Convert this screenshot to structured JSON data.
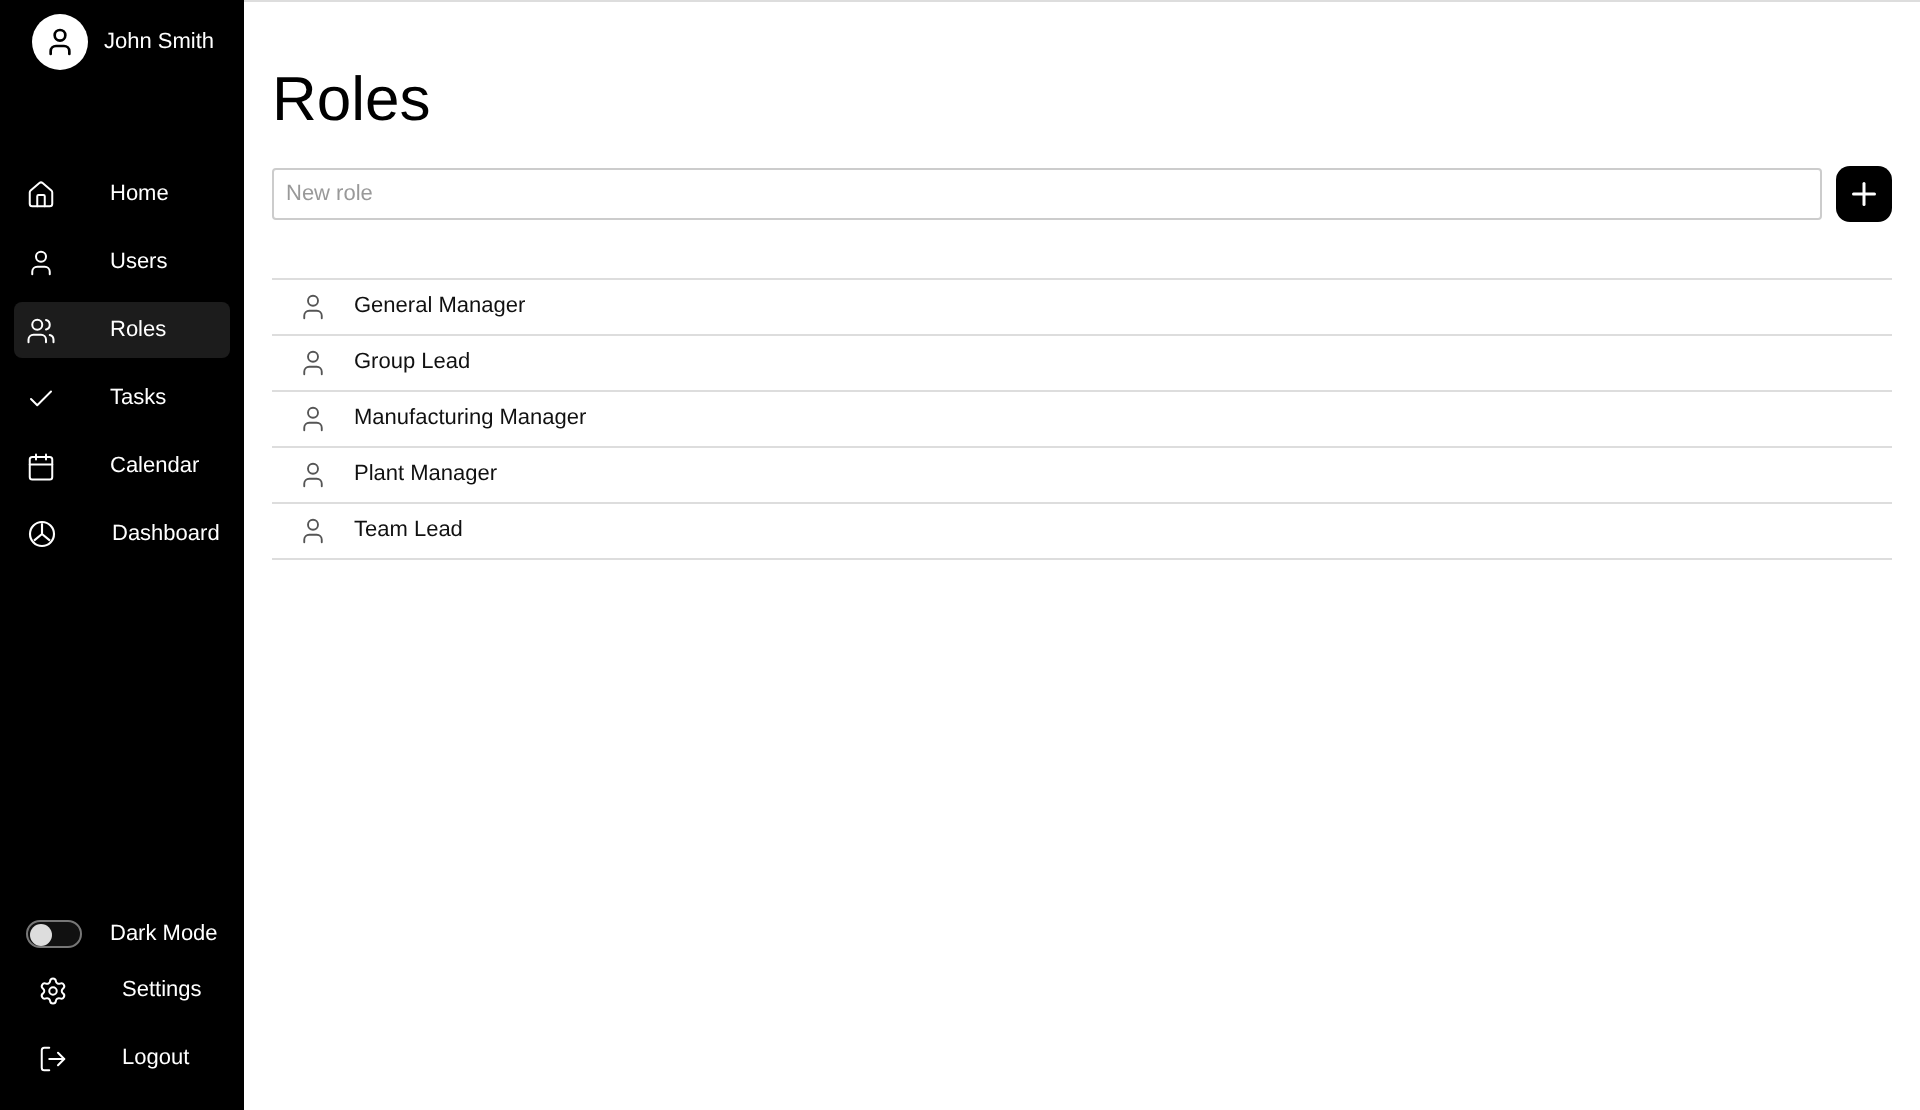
{
  "user": {
    "name": "John Smith"
  },
  "nav": [
    {
      "label": "Home",
      "selected": false
    },
    {
      "label": "Users",
      "selected": false
    },
    {
      "label": "Roles",
      "selected": true
    },
    {
      "label": "Tasks",
      "selected": false
    },
    {
      "label": "Calendar",
      "selected": false
    },
    {
      "label": "Dashboard",
      "selected": false
    }
  ],
  "dark_mode": {
    "label": "Dark Mode",
    "on": false
  },
  "footer_nav": [
    {
      "label": "Settings"
    },
    {
      "label": "Logout"
    }
  ],
  "page_title": "Roles",
  "new_role": {
    "placeholder": "New role"
  },
  "roles": [
    {
      "name": "General Manager"
    },
    {
      "name": "Group Lead"
    },
    {
      "name": "Manufacturing Manager"
    },
    {
      "name": "Plant Manager"
    },
    {
      "name": "Team Lead"
    }
  ]
}
